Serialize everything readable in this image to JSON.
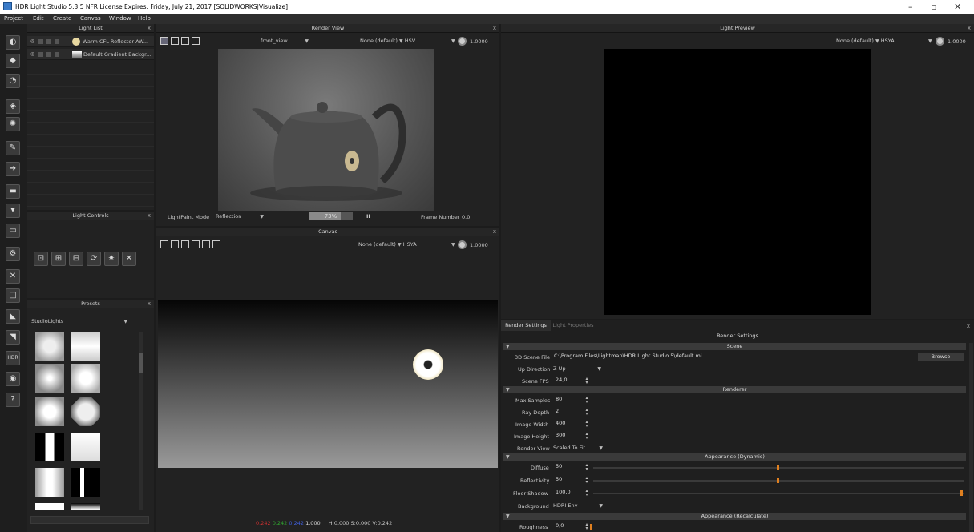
{
  "window": {
    "title": "HDR Light Studio 5.3.5 NFR License Expires: Friday, July 21, 2017  [SOLIDWORKS|Visualize]",
    "minimize": "–",
    "maximize": "▫",
    "close": "✕"
  },
  "menu": [
    "Project",
    "Edit",
    "Create",
    "Canvas",
    "Window",
    "Help"
  ],
  "light_list": {
    "title": "Light List",
    "items": [
      {
        "name": "Warm CFL Reflector AW..."
      },
      {
        "name": "Default Gradient Backgr..."
      }
    ]
  },
  "light_controls": {
    "title": "Light Controls"
  },
  "presets": {
    "title": "Presets",
    "category": "StudioLights"
  },
  "render_view": {
    "title": "Render View",
    "camera": "front_view",
    "colorspace": "None (default)",
    "mode": "HSV",
    "exposure": "1.0000",
    "lightpaint_label": "LightPaint Mode",
    "lightpaint_value": "Reflection",
    "progress": 0.73,
    "progress_text": "73%",
    "pause_icon": "II",
    "frame_label": "Frame Number",
    "frame_value": "0.0"
  },
  "canvas": {
    "title": "Canvas",
    "colorspace": "None (default)",
    "mode": "HSYA",
    "exposure": "1.0000",
    "readout_r": "0.242",
    "readout_g": "0.242",
    "readout_b": "0.242",
    "readout_a": "1.000",
    "readout_hsv": "H:0.000 S:0.000 V:0.242"
  },
  "light_preview": {
    "title": "Light Preview",
    "colorspace": "None (default)",
    "mode": "HSYA",
    "exposure": "1.0000"
  },
  "render_settings": {
    "tabs": [
      "Render Settings",
      "Light Properties"
    ],
    "header": "Render Settings",
    "scene_section": "Scene",
    "scene_file_label": "3D Scene File",
    "scene_file_value": "C:\\Program Files\\Lightmap\\HDR Light Studio 5\\default.mi",
    "browse": "Browse",
    "up_label": "Up Direction",
    "up_value": "Z-Up",
    "fps_label": "Scene FPS",
    "fps_value": "24,0",
    "renderer_section": "Renderer",
    "max_samples_label": "Max Samples",
    "max_samples_value": "80",
    "ray_depth_label": "Ray Depth",
    "ray_depth_value": "2",
    "image_width_label": "Image Width",
    "image_width_value": "400",
    "image_height_label": "Image Height",
    "image_height_value": "300",
    "render_view_label": "Render View",
    "render_view_value": "Scaled To Fit",
    "appearance_dyn_section": "Appearance (Dynamic)",
    "diffuse_label": "Diffuse",
    "diffuse_value": "50",
    "diffuse_pct": 0.5,
    "reflectivity_label": "Reflectivity",
    "reflectivity_value": "50",
    "reflectivity_pct": 0.5,
    "floor_shadow_label": "Floor Shadow",
    "floor_shadow_value": "100,0",
    "floor_shadow_pct": 1.0,
    "background_label": "Background",
    "background_value": "HDRI Env",
    "appearance_recalc_section": "Appearance (Recalculate)",
    "roughness_label": "Roughness",
    "roughness_value": "0,0"
  },
  "colors": {
    "accent": "#e08020",
    "panel": "#222222",
    "header": "#262626",
    "section": "#3a3a3a"
  }
}
